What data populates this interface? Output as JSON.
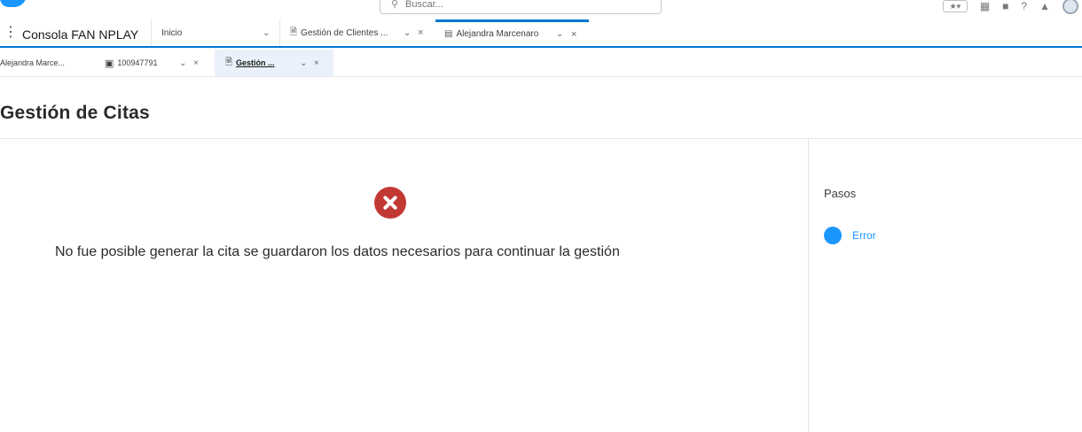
{
  "header": {
    "search_placeholder": "Buscar...",
    "icons": [
      "favorites-icon",
      "new-item-icon",
      "setup-assistant-icon",
      "help-icon",
      "notifications-icon",
      "avatar"
    ]
  },
  "app_bar": {
    "app_name": "Consola FAN NPLAY",
    "nav_dropdown": "Inicio",
    "tabs": [
      {
        "label": "Gestión de Clientes ...",
        "icon": "document-icon"
      },
      {
        "label": "Alejandra Marcenaro",
        "icon": "contact-icon"
      }
    ]
  },
  "subtabs": [
    {
      "label": "Alejandra Marce..."
    },
    {
      "label": "100947791",
      "icon": "case-briefcase-icon"
    },
    {
      "label": "Gestión ...",
      "icon": "document-icon"
    }
  ],
  "page": {
    "title": "Gestión de Citas",
    "error_message": "No fue posible generar la cita se guardaron los datos necesarios para continuar la gestión"
  },
  "steps": {
    "title": "Pasos",
    "items": [
      {
        "label": "Error",
        "status_color": "#1b96ff"
      }
    ]
  },
  "colors": {
    "accent": "#0176d3",
    "error": "#c23934",
    "step": "#1b96ff"
  }
}
